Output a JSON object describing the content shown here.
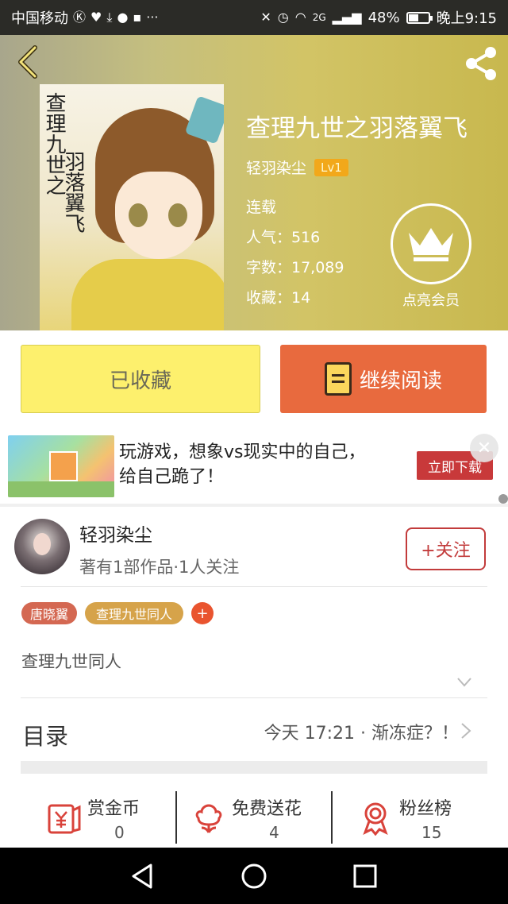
{
  "status_bar": {
    "carrier": "中国移动",
    "network": "2G",
    "battery": "48%",
    "battery_level": 0.48,
    "time": "晚上9:15"
  },
  "header": {
    "book_title": "查理九世之羽落翼飞",
    "cover_title_col1": "查理九世之",
    "cover_title_col2": "羽落翼飞",
    "author": "轻羽染尘",
    "level_badge": "Lv1",
    "status": "连载",
    "popularity": "人气：516",
    "word_count": "字数：17,089",
    "favorites": "收藏：14",
    "vip_label": "点亮会员"
  },
  "actions": {
    "favorited_label": "已收藏",
    "continue_label": "继续阅读"
  },
  "ad": {
    "text_line1": "玩游戏，想象vs现实中的自己，",
    "text_line2": "给自己跪了！",
    "cta": "立即下载"
  },
  "author_card": {
    "name": "轻羽染尘",
    "meta": "著有1部作品·1人关注",
    "follow_label": "+关注"
  },
  "tags": [
    "唐晓翼",
    "查理九世同人"
  ],
  "description": "查理九世同人",
  "toc": {
    "label": "目录",
    "latest": "今天 17:21 · 渐冻症？！"
  },
  "stats": [
    {
      "label": "赏金币",
      "value": "0"
    },
    {
      "label": "免费送花",
      "value": "4"
    },
    {
      "label": "粉丝榜",
      "value": "15"
    }
  ],
  "colors": {
    "orange": "#e86a3e",
    "yellow": "#fdf06d",
    "red": "#c23b3b",
    "lv_badge": "#f2a81a"
  }
}
